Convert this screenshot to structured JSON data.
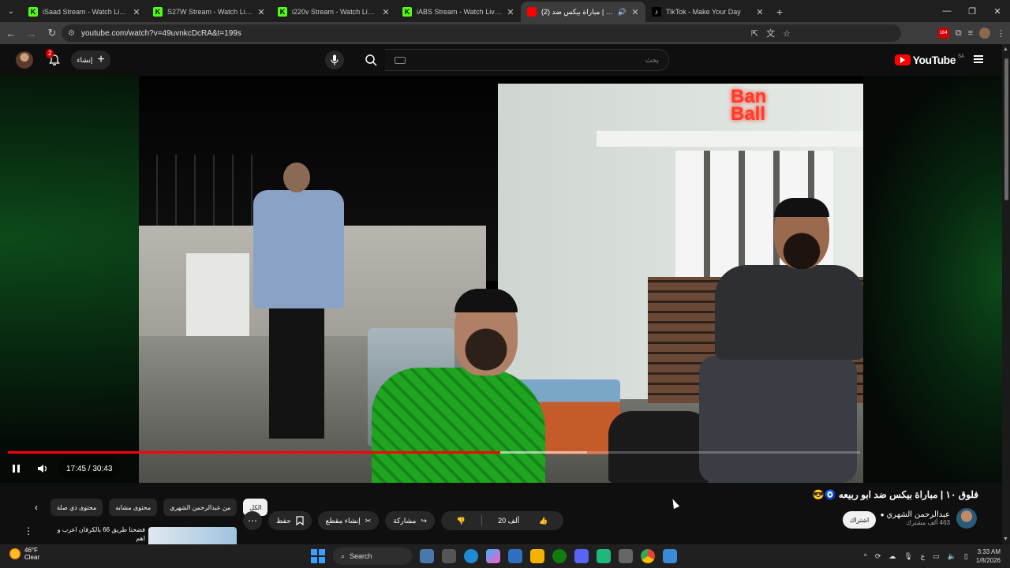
{
  "browser": {
    "tabs": [
      {
        "favicon": "kick-icon",
        "title": "iSaad Stream - Watch Live on Kick",
        "active": false
      },
      {
        "favicon": "kick-icon",
        "title": "S27W Stream - Watch Live on Kick",
        "active": false
      },
      {
        "favicon": "kick-icon",
        "title": "i220v Stream - Watch Live on Kick",
        "active": false
      },
      {
        "favicon": "kick-icon",
        "title": "iABS Stream - Watch Live on Kick",
        "active": false
      },
      {
        "favicon": "youtube-icon",
        "title": "(2) فلوق ١٠ | مباراة بيكس ضد",
        "active": true
      },
      {
        "favicon": "tiktok-icon",
        "title": "TikTok - Make Your Day",
        "active": false
      }
    ],
    "url": "youtube.com/watch?v=49uvnkcDcRA&t=199s",
    "extension_badge": "164"
  },
  "youtube": {
    "notification_count": "2",
    "create_label": "إنشاء",
    "search_placeholder": "بحث",
    "logo_text": "YouTube",
    "region": "SA"
  },
  "player": {
    "current_time": "17:45",
    "duration": "30:43",
    "time_display": "17:45 / 30:43",
    "progress_fraction": 0.578,
    "buffer_fraction": 0.68,
    "video_sign": "Ban Ball"
  },
  "video": {
    "title": "فلوق ١٠ | مباراة بيكس ضد ابو ربيعه 🧿😎",
    "channel_name": "عبدالرحمن الشهري",
    "subscribers": "463 ألف مشترك",
    "subscribe_label": "اشتراك",
    "likes": "20 ألف",
    "share_label": "مشاركة",
    "clip_label": "إنشاء مقطع",
    "save_label": "حفظ",
    "more_label": "⋯"
  },
  "chips": [
    "الكل",
    "من عبدالرحمن الشهري",
    "محتوى مشابه",
    "محتوى ذي صلة"
  ],
  "recommendation": {
    "title": "فضحنا طريق 66 بالكرفان اعرب و اهم"
  },
  "taskbar": {
    "weather_temp": "46°F",
    "weather_desc": "Clear",
    "search_label": "Search",
    "time": "3:33 AM",
    "date": "1/8/2026",
    "lang": "ع"
  }
}
